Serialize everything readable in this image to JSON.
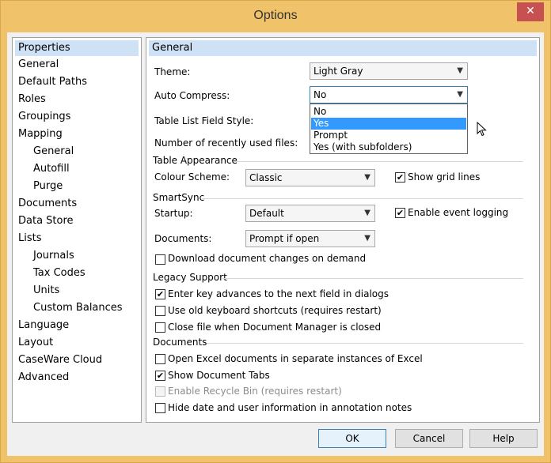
{
  "window": {
    "title": "Options",
    "close_glyph": "✕"
  },
  "nav": {
    "header": "Properties",
    "items": [
      {
        "label": "General",
        "selected": true,
        "sub": false
      },
      {
        "label": "Default Paths",
        "sub": false
      },
      {
        "label": "Roles",
        "sub": false
      },
      {
        "label": "Groupings",
        "sub": false
      },
      {
        "label": "Mapping",
        "sub": false
      },
      {
        "label": "General",
        "sub": true
      },
      {
        "label": "Autofill",
        "sub": true
      },
      {
        "label": "Purge",
        "sub": true
      },
      {
        "label": "Documents",
        "sub": false
      },
      {
        "label": "Data Store",
        "sub": false
      },
      {
        "label": "Lists",
        "sub": false
      },
      {
        "label": "Journals",
        "sub": true
      },
      {
        "label": "Tax Codes",
        "sub": true
      },
      {
        "label": "Units",
        "sub": true
      },
      {
        "label": "Custom Balances",
        "sub": true
      },
      {
        "label": "Language",
        "sub": false
      },
      {
        "label": "Layout",
        "sub": false
      },
      {
        "label": "CaseWare Cloud",
        "sub": false
      },
      {
        "label": "Advanced",
        "sub": false
      }
    ]
  },
  "pane": {
    "header": "General",
    "theme": {
      "label": "Theme:",
      "value": "Light Gray"
    },
    "auto_compress": {
      "label": "Auto Compress:",
      "value": "No",
      "options": [
        "No",
        "Yes",
        "Prompt",
        "Yes (with subfolders)"
      ],
      "highlighted": "Yes"
    },
    "table_list_field_style": {
      "label": "Table List Field Style:"
    },
    "recent_files": {
      "label": "Number of recently used files:"
    },
    "table_appearance": {
      "group": "Table Appearance",
      "colour_scheme": {
        "label": "Colour Scheme:",
        "value": "Classic"
      },
      "show_grid_lines": {
        "label": "Show grid lines",
        "checked": true
      }
    },
    "smartsync": {
      "group": "SmartSync",
      "startup": {
        "label": "Startup:",
        "value": "Default"
      },
      "enable_event_logging": {
        "label": "Enable event logging",
        "checked": true
      },
      "documents": {
        "label": "Documents:",
        "value": "Prompt if open"
      },
      "download_changes": {
        "label": "Download document changes on demand",
        "checked": false
      }
    },
    "legacy_support": {
      "group": "Legacy Support",
      "enter_key": {
        "label": "Enter key advances to the next field in dialogs",
        "checked": true
      },
      "old_shortcuts": {
        "label": "Use old keyboard shortcuts (requires restart)",
        "checked": false
      },
      "close_file": {
        "label": "Close file when Document Manager is closed",
        "checked": false
      }
    },
    "documents": {
      "group": "Documents",
      "open_excel": {
        "label": "Open Excel documents in separate instances of Excel",
        "checked": false
      },
      "show_tabs": {
        "label": "Show Document Tabs",
        "checked": true
      },
      "recycle_bin": {
        "label": "Enable Recycle Bin (requires restart)",
        "checked": false,
        "disabled": true
      },
      "hide_date": {
        "label": "Hide date and user information in annotation notes",
        "checked": false
      }
    }
  },
  "buttons": {
    "ok": "OK",
    "cancel": "Cancel",
    "help": "Help"
  },
  "icons": {
    "dropdown_arrow": "chevron-down-icon",
    "check": "✔",
    "arrow_glyph": "⌄"
  },
  "colors": {
    "title_bar": "#f0c36a",
    "header_bg": "#cfe1f5",
    "highlight": "#3399ff",
    "close": "#c75050"
  }
}
